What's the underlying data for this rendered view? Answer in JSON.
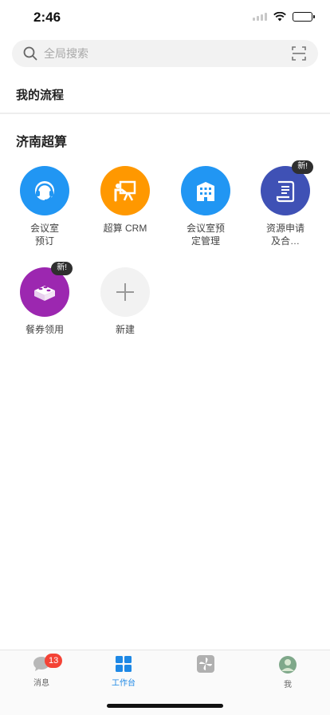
{
  "status_bar": {
    "time": "2:46"
  },
  "search": {
    "placeholder": "全局搜索"
  },
  "my_process": {
    "label": "我的流程"
  },
  "section": {
    "title": "济南超算"
  },
  "apps": [
    {
      "label": "会议室\n预订",
      "icon": "headset-icon",
      "color": "#2196f3",
      "badge": ""
    },
    {
      "label": "超算 CRM",
      "icon": "presentation-icon",
      "color": "#ff9800",
      "badge": ""
    },
    {
      "label": "会议室预\n定管理",
      "icon": "building-icon",
      "color": "#2196f3",
      "badge": ""
    },
    {
      "label": "资源申请\n及合…",
      "icon": "document-icon",
      "color": "#3f51b5",
      "badge": "新!"
    },
    {
      "label": "餐券领用",
      "icon": "box-icon",
      "color": "#9c27b0",
      "badge": "新!"
    },
    {
      "label": "新建",
      "icon": "plus-icon",
      "color": "#f2f2f2",
      "badge": ""
    }
  ],
  "tabs": [
    {
      "label": "消息",
      "icon": "chat-icon",
      "badge": "13",
      "active": false
    },
    {
      "label": "工作台",
      "icon": "grid-icon",
      "badge": "",
      "active": true
    },
    {
      "label": "",
      "icon": "pinwheel-icon",
      "badge": "",
      "active": false
    },
    {
      "label": "我",
      "icon": "avatar",
      "badge": "",
      "active": false
    }
  ],
  "colors": {
    "accent": "#1e88e5",
    "badge_red": "#f44336"
  }
}
